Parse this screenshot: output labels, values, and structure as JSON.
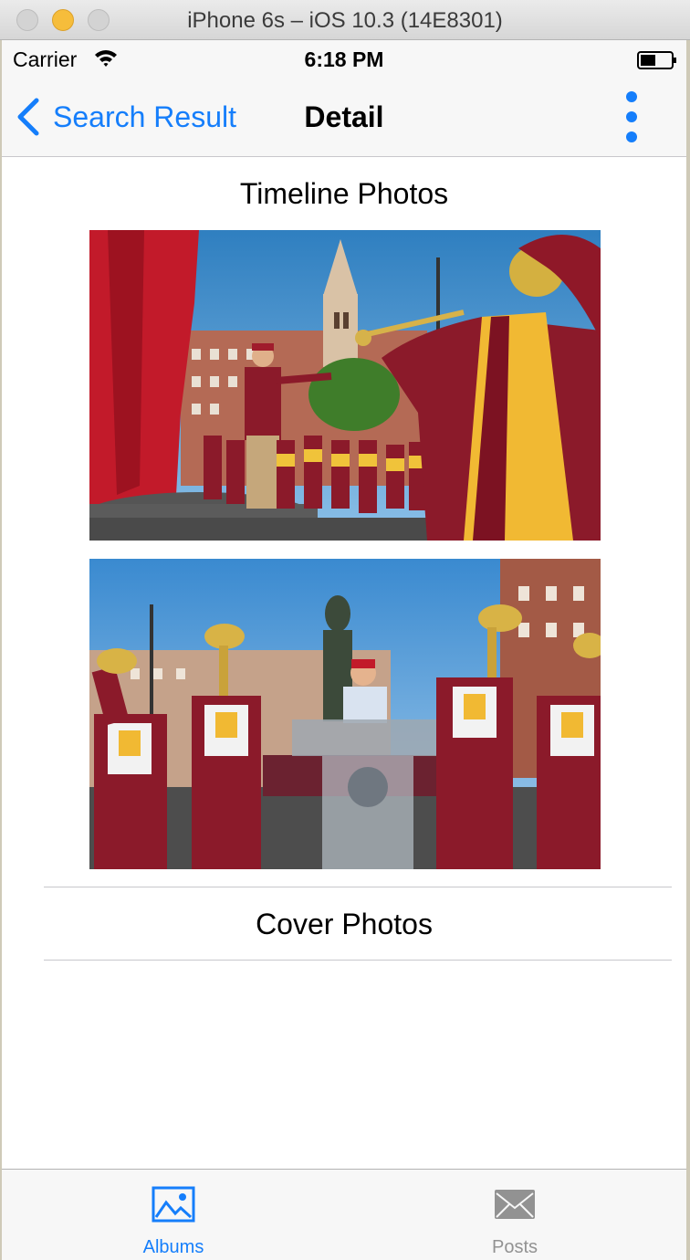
{
  "window": {
    "title": "iPhone 6s – iOS 10.3 (14E8301)"
  },
  "status_bar": {
    "carrier": "Carrier",
    "time": "6:18 PM"
  },
  "nav": {
    "back_label": "Search Result",
    "title": "Detail"
  },
  "sections": {
    "timeline": "Timeline Photos",
    "cover": "Cover Photos"
  },
  "tabs": [
    {
      "label": "Albums",
      "selected": true,
      "icon": "photo-album-icon"
    },
    {
      "label": "Posts",
      "selected": false,
      "icon": "envelope-icon"
    }
  ],
  "colors": {
    "accent": "#157efb",
    "inactive": "#929292"
  }
}
